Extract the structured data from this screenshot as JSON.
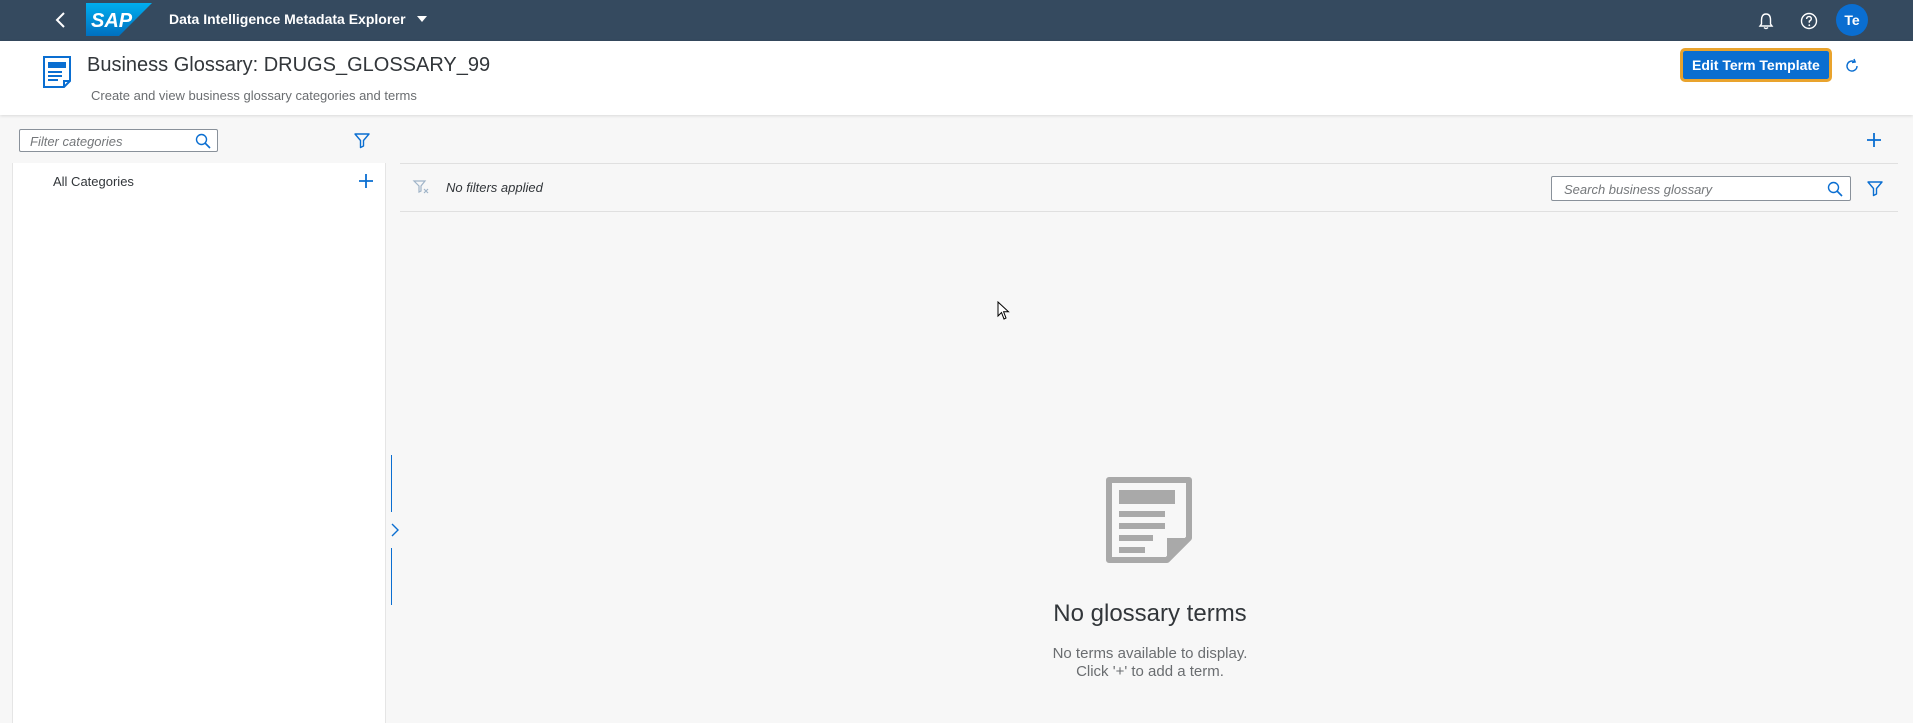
{
  "shell": {
    "logo_text": "SAP",
    "app_title": "Data Intelligence Metadata Explorer",
    "avatar_initials": "Te",
    "icons": [
      "back-icon",
      "caret-down-icon",
      "bell-icon",
      "help-icon"
    ]
  },
  "header": {
    "title": "Business Glossary: DRUGS_GLOSSARY_99",
    "subtitle": "Create and view business glossary categories and terms",
    "edit_template_label": "Edit Term Template"
  },
  "categories": {
    "filter_placeholder": "Filter categories",
    "items": [
      {
        "label": "All Categories"
      }
    ]
  },
  "terms": {
    "filter_status": "No filters applied",
    "search_placeholder": "Search business glossary",
    "empty_title": "No glossary terms",
    "empty_line1": "No terms available to display.",
    "empty_line2": "Click '+' to add a term."
  },
  "colors": {
    "shell_bg": "#354a5f",
    "accent": "#0a6ed1",
    "focus_outline": "#e9a32d",
    "page_bg": "#f7f7f7"
  }
}
